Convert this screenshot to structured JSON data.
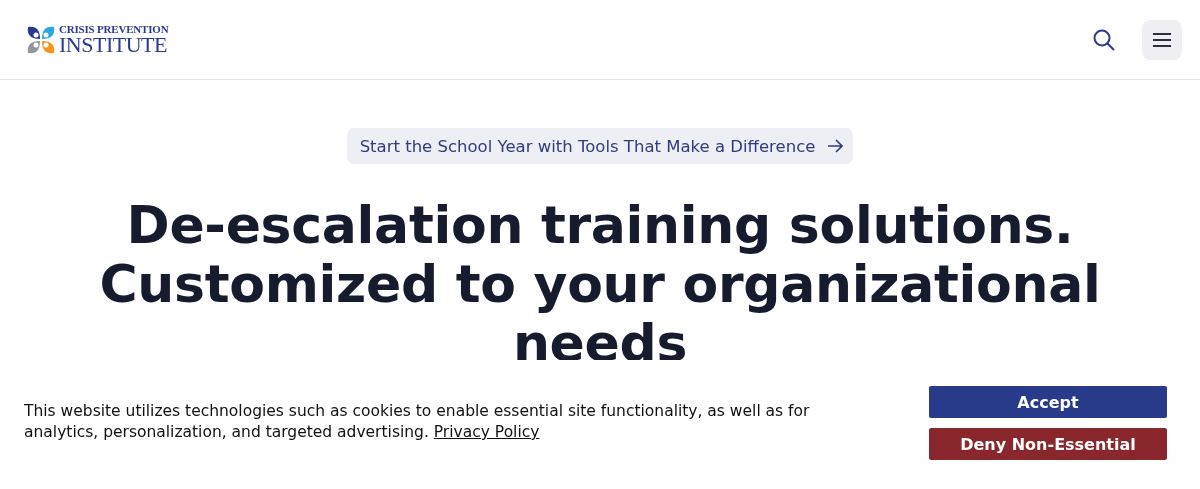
{
  "logo": {
    "line_1": "CRISIS PREVENTION",
    "line_2": "INSTITUTE"
  },
  "announcement": {
    "label": "Start the School Year with Tools That Make a Difference"
  },
  "hero": {
    "headline_lines": [
      "De-escalation training solutions.",
      "Customized to your organizational",
      "needs"
    ]
  },
  "cookie_banner": {
    "text": "This website utilizes technologies such as cookies to enable essential site functionality, as well as for analytics, personalization, and targeted advertising.",
    "link": "Privacy Policy",
    "buttons": [
      {
        "label": "Accept",
        "kind": "primary"
      },
      {
        "label": "Deny Non-Essential",
        "kind": "danger"
      }
    ]
  }
}
